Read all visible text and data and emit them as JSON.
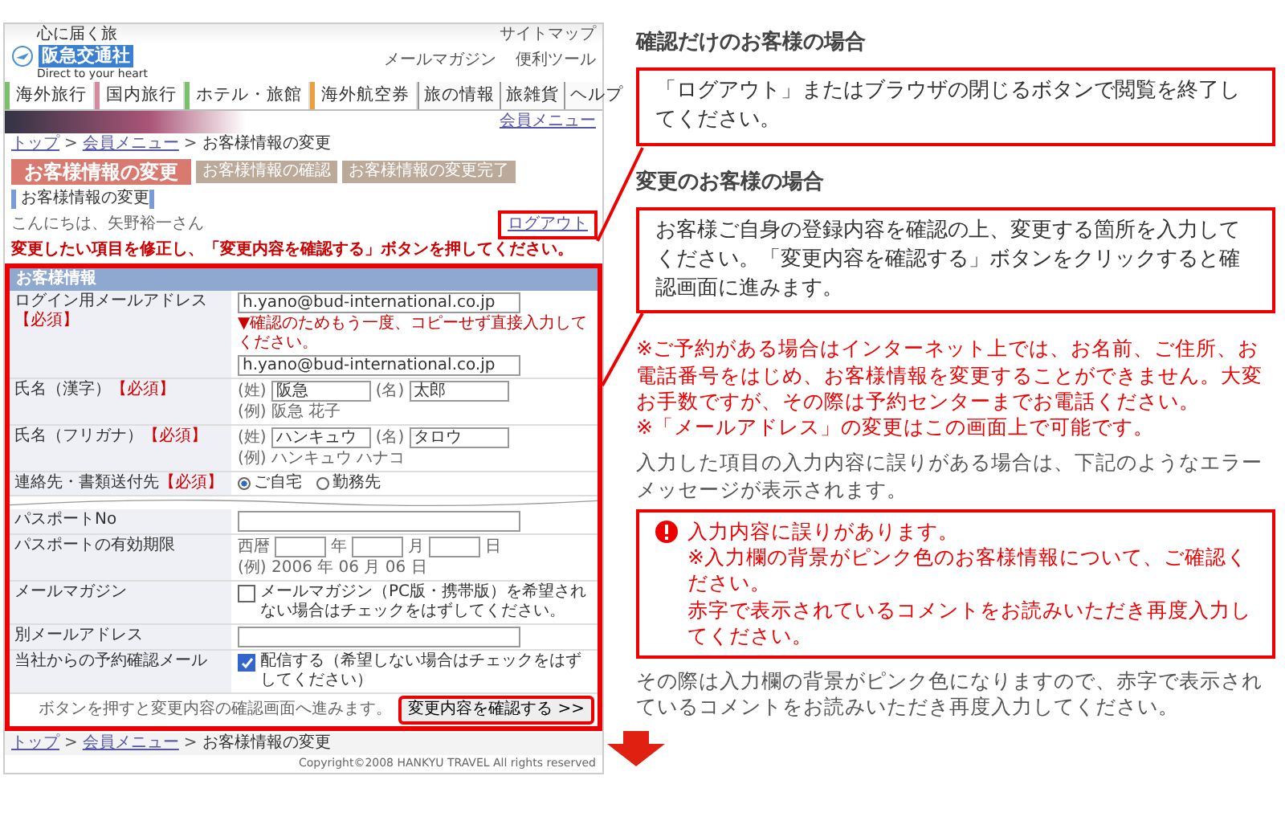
{
  "site_page": {
    "logo": {
      "tagline": "心に届く旅",
      "name": "阪急交通社",
      "slogan": "Direct to your heart"
    },
    "sitemap": "サイトマップ",
    "utility_links": [
      "メールマガジン",
      "便利ツール"
    ],
    "nav_tabs": [
      {
        "label": "海外旅行"
      },
      {
        "label": "国内旅行"
      },
      {
        "label": "ホテル・旅館"
      },
      {
        "label": "海外航空券"
      }
    ],
    "nav_links": [
      "旅の情報",
      "旅雑貨",
      "ヘルプ"
    ],
    "member_menu": "会員メニュー",
    "breadcrumb": [
      {
        "kind": "link",
        "text": "トップ"
      },
      {
        "kind": "sep",
        "text": ">"
      },
      {
        "kind": "link",
        "text": "会員メニュー"
      },
      {
        "kind": "sep",
        "text": ">"
      },
      {
        "kind": "current",
        "text": "お客様情報の変更"
      }
    ],
    "steps": [
      {
        "label": "お客様情報の変更",
        "selected": true
      },
      {
        "label": "お客様情報の確認",
        "selected": false
      },
      {
        "label": "お客様情報の変更完了",
        "selected": false
      }
    ],
    "section_title": "お客様情報の変更",
    "greeting": "こんにちは、矢野裕一さん",
    "logout": "ログアウト",
    "instruction": "変更したい項目を修正し、「変更内容を確認する」ボタンを押してください。",
    "form": {
      "title": "お客様情報",
      "rows": [
        {
          "kind": "email",
          "label": "ログイン用メールアドレス",
          "required_mark": "【必須】",
          "value": "h.yano@bud-international.co.jp",
          "confirm_note": "▼確認のためもう一度、コピーせず直接入力してください。",
          "confirm_value": "h.yano@bud-international.co.jp"
        },
        {
          "kind": "name",
          "label": "氏名（漢字）",
          "required_mark": "【必須】",
          "fields": [
            {
              "prefix": "(姓)",
              "value": "阪急"
            },
            {
              "prefix": "(名)",
              "value": "太郎"
            }
          ],
          "example": "(例) 阪急 花子"
        },
        {
          "kind": "name",
          "label": "氏名（フリガナ）",
          "required_mark": "【必須】",
          "fields": [
            {
              "prefix": "(姓)",
              "value": "ハンキュウ"
            },
            {
              "prefix": "(名)",
              "value": "タロウ"
            }
          ],
          "example": "(例) ハンキュウ ハナコ"
        },
        {
          "kind": "radio",
          "label": "連絡先・書類送付先",
          "required_mark": "【必須】",
          "options": [
            {
              "label": "ご自宅",
              "selected": true
            },
            {
              "label": "勤務先",
              "selected": false
            }
          ]
        },
        {
          "kind": "break"
        },
        {
          "kind": "text",
          "label": "パスポートNo"
        },
        {
          "kind": "date",
          "label": "パスポートの有効期限",
          "era": "西暦",
          "units": [
            "年",
            "月",
            "日"
          ],
          "example": "(例) 2006 年 06 月 06 日"
        },
        {
          "kind": "check",
          "label": "メールマガジン",
          "checked": false,
          "text": "メールマガジン（PC版・携帯版）を希望されない場合はチェックをはずしてください。"
        },
        {
          "kind": "text",
          "label": "別メールアドレス"
        },
        {
          "kind": "check",
          "label": "当社からの予約確認メール",
          "checked": true,
          "text": "配信する（希望しない場合はチェックをはずしてください）"
        }
      ],
      "submit_note": "ボタンを押すと変更内容の確認画面へ進みます。",
      "submit": "変更内容を確認する >>"
    },
    "footer_breadcrumb": [
      {
        "kind": "link",
        "text": "トップ"
      },
      {
        "kind": "sep",
        "text": ">"
      },
      {
        "kind": "link",
        "text": "会員メニュー"
      },
      {
        "kind": "sep",
        "text": ">"
      },
      {
        "kind": "current",
        "text": "お客様情報の変更"
      }
    ],
    "copyright": "Copyright©2008 HANKYU TRAVEL All rights reserved"
  },
  "guide": {
    "confirm_heading": "確認だけのお客様の場合",
    "confirm_text": "「ログアウト」またはブラウザの閉じるボタンで閲覧を終了してください。",
    "change_heading": "変更のお客様の場合",
    "change_text": "お客様ご自身の登録内容を確認の上、変更する箇所を入力してください。「変更内容を確認する」ボタンをクリックすると確認画面に進みます。",
    "notes": [
      "※ご予約がある場合はインターネット上では、お名前、ご住所、お電話番号をはじめ、お客様情報を変更することができません。大変お手数ですが、その際は予約センターまでお電話ください。",
      "※「メールアドレス」の変更はこの画面上で可能です。"
    ],
    "error_intro": "入力した項目の入力内容に誤りがある場合は、下記のようなエラーメッセージが表示されます。",
    "error_box": {
      "title": "入力内容に誤りがあります。",
      "lines": [
        "※入力欄の背景がピンク色のお客様情報について、ご確認ください。",
        "赤字で表示されているコメントをお読みいただき再度入力してください。"
      ]
    },
    "after_text": "その際は入力欄の背景がピンク色になりますので、赤字で表示されているコメントをお読みいただき再度入力してください。"
  }
}
